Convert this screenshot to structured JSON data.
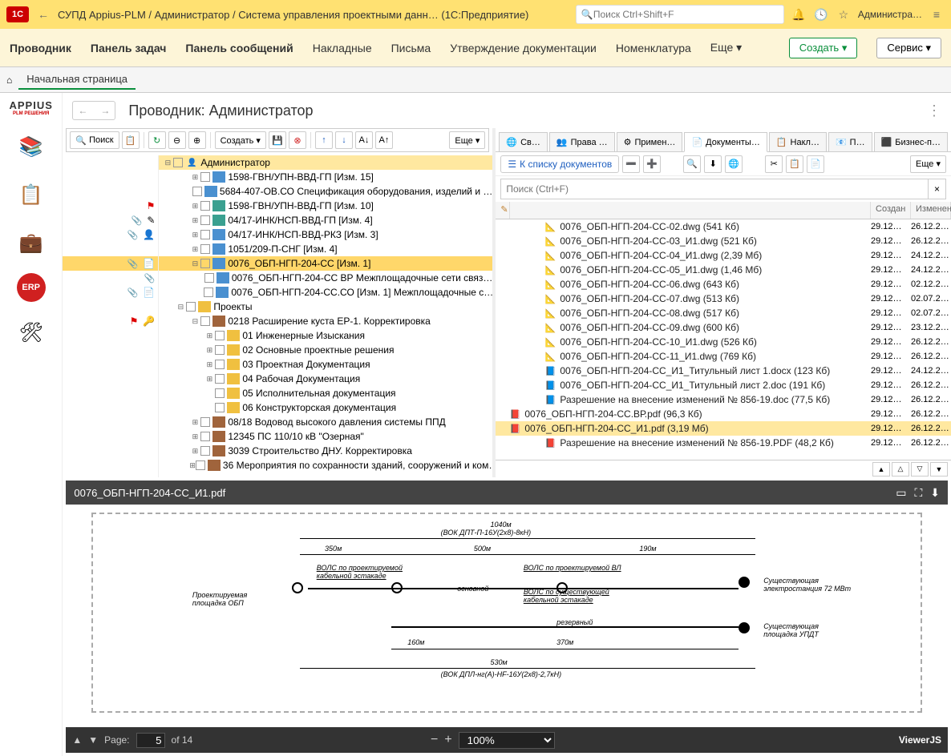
{
  "titlebar": {
    "app": "1С",
    "title": "СУПД Appius-PLM / Администратор / Система управления проектными данн…   (1С:Предприятие)",
    "search_placeholder": "Поиск Ctrl+Shift+F",
    "user": "Администра…"
  },
  "menu": {
    "items": [
      "Проводник",
      "Панель задач",
      "Панель сообщений",
      "Накладные",
      "Письма",
      "Утверждение документации",
      "Номенклатура"
    ],
    "more": "Еще ▾",
    "create": "Создать ▾",
    "service": "Сервис ▾"
  },
  "breadcrumb": {
    "home": "Начальная страница"
  },
  "sidebar": {
    "logo": "APPIUS",
    "logo_sub": "PLM РЕШЕНИЯ"
  },
  "workspace": {
    "title": "Проводник: Администратор"
  },
  "left_toolbar": {
    "search": "Поиск",
    "create": "Создать ▾",
    "more": "Еще ▾"
  },
  "tree": {
    "root": "Администратор",
    "nodes": [
      {
        "indent": 1,
        "icon": "doc-blue",
        "label": "1598-ГВН/УПН-ВВД-ГП  [Изм. 15]",
        "exp": "+"
      },
      {
        "indent": 1,
        "icon": "doc-blue",
        "label": "5684-407-ОВ.СО Спецификация оборудования, изделий и …"
      },
      {
        "indent": 1,
        "icon": "doc-teal",
        "label": "1598-ГВН/УПН-ВВД-ГП  [Изм. 10]",
        "exp": "+"
      },
      {
        "indent": 1,
        "icon": "doc-teal",
        "label": "04/17-ИНК/НСП-ВВД-ГП  [Изм. 4]",
        "exp": "+"
      },
      {
        "indent": 1,
        "icon": "doc-blue",
        "label": "04/17-ИНК/НСП-ВВД-РКЗ  [Изм. 3]",
        "exp": "+"
      },
      {
        "indent": 1,
        "icon": "doc-blue",
        "label": "1051/209-П-СНГ  [Изм. 4]",
        "exp": "+"
      },
      {
        "indent": 1,
        "icon": "doc-blue",
        "label": "0076_ОБП-НГП-204-СС  [Изм. 1]",
        "exp": "–",
        "sel": true
      },
      {
        "indent": 2,
        "icon": "doc-blue",
        "label": "0076_ОБП-НГП-204-СС ВР Межплощадочные сети связ…"
      },
      {
        "indent": 2,
        "icon": "doc-blue",
        "label": "0076_ОБП-НГП-204-СС.СО [Изм. 1] Межплощадочные с…"
      },
      {
        "indent": 0,
        "icon": "folder",
        "label": "Проекты",
        "exp": "–"
      },
      {
        "indent": 1,
        "icon": "doc-brown",
        "label": "0218 Расширение куста ЕР-1. Корректировка",
        "exp": "–"
      },
      {
        "indent": 2,
        "icon": "folder",
        "label": "01 Инженерные Изыскания",
        "exp": "+"
      },
      {
        "indent": 2,
        "icon": "folder",
        "label": "02 Основные проектные решения",
        "exp": "+"
      },
      {
        "indent": 2,
        "icon": "folder",
        "label": "03 Проектная Документация",
        "exp": "+"
      },
      {
        "indent": 2,
        "icon": "folder",
        "label": "04 Рабочая Документация",
        "exp": "+"
      },
      {
        "indent": 2,
        "icon": "folder",
        "label": "05 Исполнительная документация"
      },
      {
        "indent": 2,
        "icon": "folder",
        "label": "06 Конструкторская документация"
      },
      {
        "indent": 1,
        "icon": "doc-brown",
        "label": "08/18 Водовод высокого давления системы ППД",
        "exp": "+"
      },
      {
        "indent": 1,
        "icon": "doc-brown",
        "label": "12345 ПС 110/10 кВ \"Озерная\"",
        "exp": "+"
      },
      {
        "indent": 1,
        "icon": "doc-brown",
        "label": "3039 Строительство ДНУ. Корректировка",
        "exp": "+"
      },
      {
        "indent": 1,
        "icon": "doc-brown",
        "label": "36 Мероприятия по сохранности зданий, сооружений и ком…",
        "exp": "+"
      }
    ]
  },
  "right": {
    "tabs": [
      "Св…",
      "Права …",
      "Примен…",
      "Документы…",
      "Накл…",
      "П…",
      "Бизнес-п…"
    ],
    "active_tab": 3,
    "back_link": "К списку документов",
    "more": "Еще ▾",
    "search_placeholder": "Поиск (Ctrl+F)",
    "cols": {
      "name": "",
      "c1": "Создан",
      "c2": "Изменен"
    }
  },
  "files": [
    {
      "icon": "dwg",
      "name": "0076_ОБП-НГП-204-СС-02.dwg (541 Кб)",
      "c1": "29.12…",
      "c2": "26.12.2…"
    },
    {
      "icon": "dwg",
      "name": "0076_ОБП-НГП-204-СС-03_И1.dwg (521 Кб)",
      "c1": "29.12…",
      "c2": "26.12.2…"
    },
    {
      "icon": "dwg",
      "name": "0076_ОБП-НГП-204-СС-04_И1.dwg (2,39 Мб)",
      "c1": "29.12…",
      "c2": "24.12.2…"
    },
    {
      "icon": "dwg",
      "name": "0076_ОБП-НГП-204-СС-05_И1.dwg (1,46 Мб)",
      "c1": "29.12…",
      "c2": "24.12.2…"
    },
    {
      "icon": "dwg",
      "name": "0076_ОБП-НГП-204-СС-06.dwg (643 Кб)",
      "c1": "29.12…",
      "c2": "02.12.2…"
    },
    {
      "icon": "dwg",
      "name": "0076_ОБП-НГП-204-СС-07.dwg (513 Кб)",
      "c1": "29.12…",
      "c2": "02.07.2…"
    },
    {
      "icon": "dwg",
      "name": "0076_ОБП-НГП-204-СС-08.dwg (517 Кб)",
      "c1": "29.12…",
      "c2": "02.07.2…"
    },
    {
      "icon": "dwg",
      "name": "0076_ОБП-НГП-204-СС-09.dwg (600 Кб)",
      "c1": "29.12…",
      "c2": "23.12.2…"
    },
    {
      "icon": "dwg",
      "name": "0076_ОБП-НГП-204-СС-10_И1.dwg (526 Кб)",
      "c1": "29.12…",
      "c2": "26.12.2…"
    },
    {
      "icon": "dwg",
      "name": "0076_ОБП-НГП-204-СС-11_И1.dwg (769 Кб)",
      "c1": "29.12…",
      "c2": "26.12.2…"
    },
    {
      "icon": "docx",
      "name": "0076_ОБП-НГП-204-СС_И1_Титульный лист 1.docx (123 Кб)",
      "c1": "29.12…",
      "c2": "24.12.2…"
    },
    {
      "icon": "docx",
      "name": "0076_ОБП-НГП-204-СС_И1_Титульный лист 2.doc (191 Кб)",
      "c1": "29.12…",
      "c2": "26.12.2…"
    },
    {
      "icon": "docx",
      "name": "Разрешение на внесение изменений № 856-19.doc (77,5 Кб)",
      "c1": "29.12…",
      "c2": "26.12.2…"
    },
    {
      "icon": "pdf",
      "name": "0076_ОБП-НГП-204-СС.ВР.pdf (96,3 Кб)",
      "c1": "29.12…",
      "c2": "26.12.2…",
      "indent": -44
    },
    {
      "icon": "pdf",
      "name": "0076_ОБП-НГП-204-СС_И1.pdf (3,19 Мб)",
      "c1": "29.12…",
      "c2": "26.12.2…",
      "sel": true,
      "indent": -44
    },
    {
      "icon": "pdf",
      "name": "Разрешение на внесение изменений № 856-19.PDF (48,2 Кб)",
      "c1": "29.12…",
      "c2": "26.12.2…"
    }
  ],
  "viewer": {
    "filename": "0076_ОБП-НГП-204-СС_И1.pdf",
    "page_label": "Page:",
    "page": "5",
    "pages": "of 14",
    "zoom": "100%",
    "brand": "ViewerJS",
    "diag": {
      "l1040": "1040м",
      "l350": "350м",
      "l500": "500м",
      "l190": "190м",
      "l160": "160м",
      "l370": "370м",
      "l530": "530м",
      "vok1": "(ВОК ДПТ-П-16У(2х8)-8кН)",
      "vok2": "(ВОК ДПЛ-нг(А)-HF-16У(2х8)-2,7кН)",
      "t_osn": "основной",
      "t_rez": "резервный",
      "t_p1": "Проектируемая",
      "t_p2": "площадка ОБП",
      "t_s1": "Существующая",
      "t_s2": "электростанция 72 МВт",
      "t_u1": "Существующая",
      "t_u2": "площадка УПДТ",
      "t_v1": "ВОЛС по проектируемой",
      "t_v2": "кабельной эстакаде",
      "t_v3": "ВОЛС по проектируемой ВЛ",
      "t_v4": "ВОЛС по существующей",
      "t_v5": "кабельной эстакаде"
    }
  }
}
